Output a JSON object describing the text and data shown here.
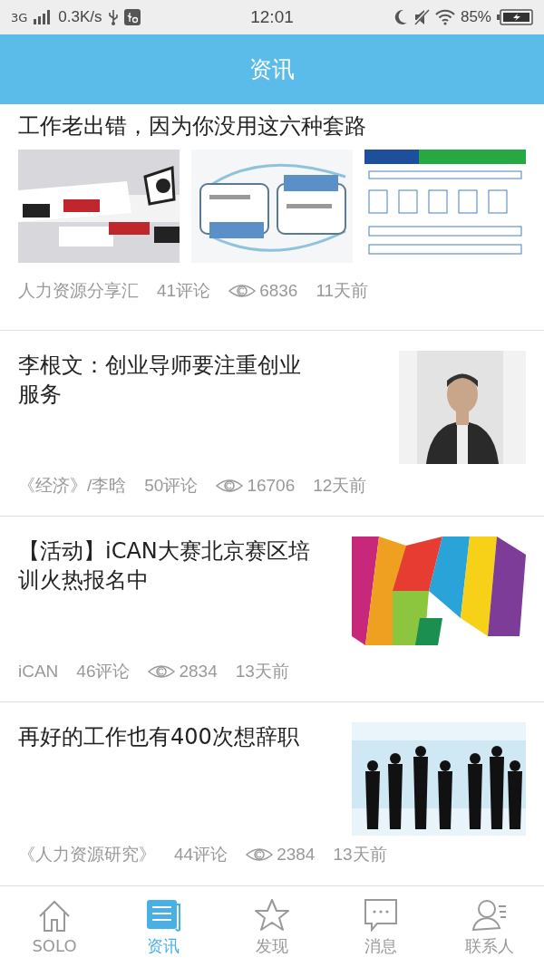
{
  "status_bar": {
    "network": "3G",
    "speed": "0.3K/s",
    "time": "12:01",
    "battery": "85%"
  },
  "header": {
    "title": "资讯"
  },
  "articles": [
    {
      "kind": "gallery",
      "title": "工作老出错，因为你没用这六种套路",
      "source": "人力资源分享汇",
      "comments": "41评论",
      "views": "6836",
      "age": "11天前"
    },
    {
      "kind": "thumbnail",
      "title": "李根文：创业导师要注重创业服务",
      "source": "《经济》/李晗",
      "comments": "50评论",
      "views": "16706",
      "age": "12天前"
    },
    {
      "kind": "thumbnail",
      "title": "【活动】iCAN大赛北京赛区培训火热报名中",
      "source": "iCAN",
      "comments": "46评论",
      "views": "2834",
      "age": "13天前"
    },
    {
      "kind": "thumbnail",
      "title": "再好的工作也有400次想辞职",
      "source": "《人力资源研究》",
      "comments": "44评论",
      "views": "2384",
      "age": "13天前"
    }
  ],
  "nav": [
    {
      "label": "SOLO",
      "selected": false
    },
    {
      "label": "资讯",
      "selected": true
    },
    {
      "label": "发现",
      "selected": false
    },
    {
      "label": "消息",
      "selected": false
    },
    {
      "label": "联系人",
      "selected": false
    }
  ]
}
